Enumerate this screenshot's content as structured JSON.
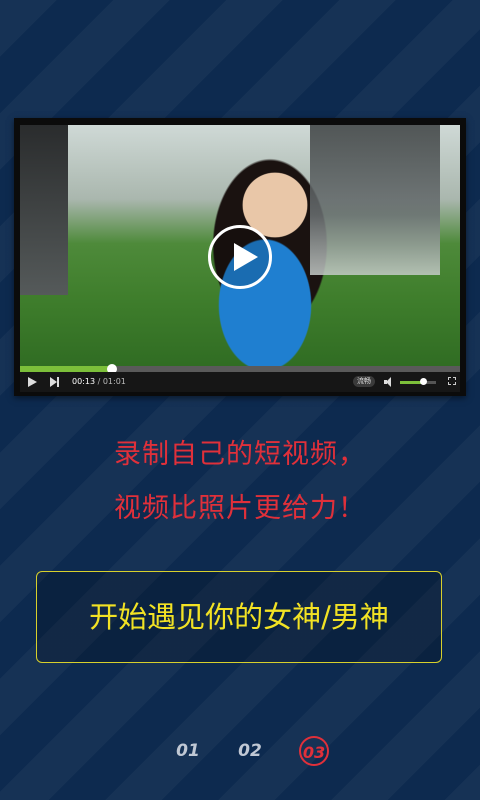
{
  "player": {
    "current_time": "00:13",
    "separator": " / ",
    "total_time": "01:01",
    "progress": 0.21,
    "quality_label": "流畅",
    "volume": 0.65
  },
  "caption": {
    "line1": "录制自己的短视频，",
    "line2": "视频比照片更给力！"
  },
  "cta": {
    "label": "开始遇见你的女神/男神"
  },
  "pager": {
    "pages": [
      "01",
      "02",
      "03"
    ],
    "active_index": 2
  },
  "colors": {
    "background": "#0d2a4f",
    "caption": "#e0303a",
    "cta_text": "#f2e224",
    "progress": "#7cbf3a"
  }
}
